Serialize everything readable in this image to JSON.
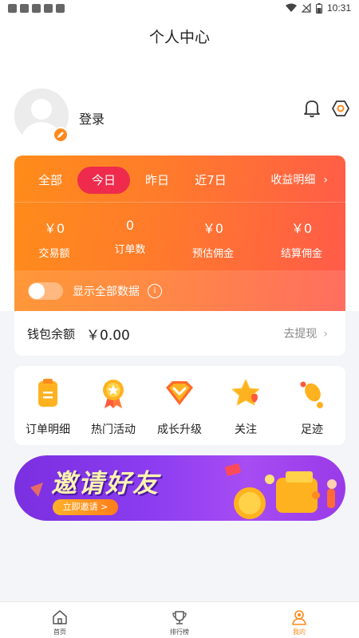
{
  "status_bar": {
    "time": "10:31"
  },
  "header": {
    "title": "个人中心"
  },
  "profile": {
    "login_label": "登录"
  },
  "earnings": {
    "tabs": [
      {
        "label": "全部",
        "active": false
      },
      {
        "label": "今日",
        "active": true
      },
      {
        "label": "昨日",
        "active": false
      },
      {
        "label": "近7日",
        "active": false
      }
    ],
    "detail_link": "收益明细",
    "stats": [
      {
        "value": "￥0",
        "label": "交易额"
      },
      {
        "value": "0",
        "label": "订单数"
      },
      {
        "value": "￥0",
        "label": "预估佣金"
      },
      {
        "value": "￥0",
        "label": "结算佣金"
      }
    ],
    "show_all_label": "显示全部数据",
    "show_all_enabled": false
  },
  "wallet": {
    "label": "钱包余额",
    "amount": "￥0.00",
    "withdraw_label": "去提现"
  },
  "shortcuts": [
    {
      "label": "订单明细",
      "icon": "order-detail-icon"
    },
    {
      "label": "热门活动",
      "icon": "hot-activity-icon"
    },
    {
      "label": "成长升级",
      "icon": "growth-upgrade-icon"
    },
    {
      "label": "关注",
      "icon": "follow-star-icon"
    },
    {
      "label": "足迹",
      "icon": "footprint-icon"
    }
  ],
  "banner": {
    "title": "邀请好友",
    "button_label": "立即邀请 >"
  },
  "bottom_nav": [
    {
      "label": "首页",
      "icon": "home-icon",
      "active": false
    },
    {
      "label": "排行榜",
      "icon": "ranking-icon",
      "active": false
    },
    {
      "label": "我的",
      "icon": "profile-icon",
      "active": true
    }
  ],
  "colors": {
    "accent_orange": "#ff8a1e",
    "active_tab_red": "#ee2b4c",
    "banner_purple": "#8b3cf0"
  }
}
